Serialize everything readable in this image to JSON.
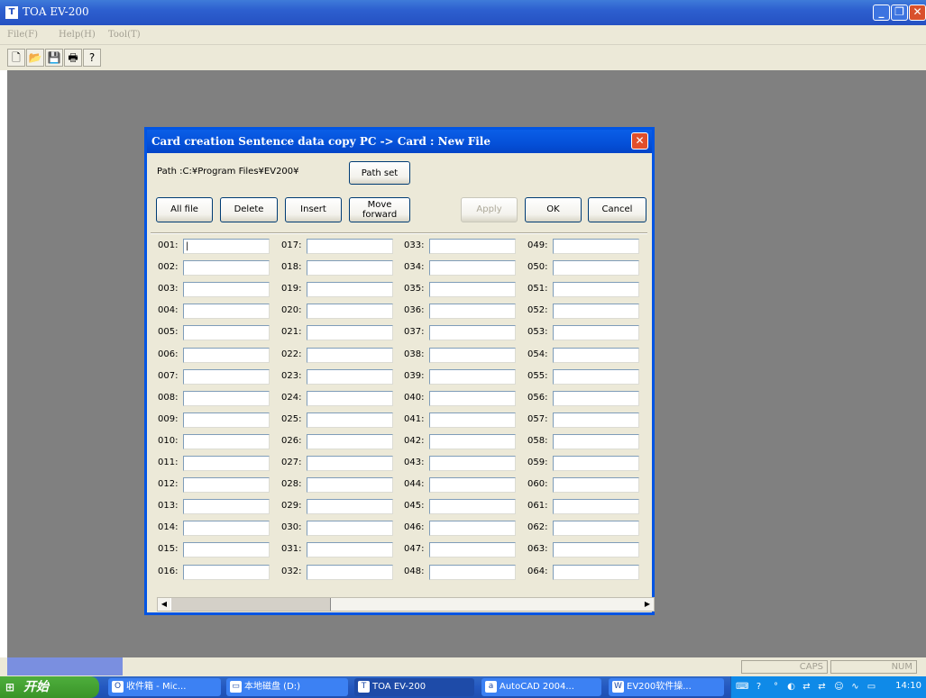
{
  "app": {
    "title": "TOA EV-200",
    "menu": [
      "File(F)",
      "Help(H)",
      "Tool(T)"
    ],
    "toolbar_icons": [
      "new-file-icon",
      "open-folder-icon",
      "save-disk-icon",
      "print-icon",
      "help-icon"
    ]
  },
  "dialog": {
    "title": "Card creation Sentence data copy PC -> Card : New File",
    "path_label": "Path :C:¥Program Files¥EV200¥",
    "buttons": {
      "path_set": "Path set",
      "all_file": "All file",
      "delete": "Delete",
      "insert": "Insert",
      "move_forward_1": "Move",
      "move_forward_2": "forward",
      "apply": "Apply",
      "ok": "OK",
      "cancel": "Cancel"
    },
    "columns": [
      [
        "001:",
        "002:",
        "003:",
        "004:",
        "005:",
        "006:",
        "007:",
        "008:",
        "009:",
        "010:",
        "011:",
        "012:",
        "013:",
        "014:",
        "015:",
        "016:"
      ],
      [
        "017:",
        "018:",
        "019:",
        "020:",
        "021:",
        "022:",
        "023:",
        "024:",
        "025:",
        "026:",
        "027:",
        "028:",
        "029:",
        "030:",
        "031:",
        "032:"
      ],
      [
        "033:",
        "034:",
        "035:",
        "036:",
        "037:",
        "038:",
        "039:",
        "040:",
        "041:",
        "042:",
        "043:",
        "044:",
        "045:",
        "046:",
        "047:",
        "048:"
      ],
      [
        "049:",
        "050:",
        "051:",
        "052:",
        "053:",
        "054:",
        "055:",
        "056:",
        "057:",
        "058:",
        "059:",
        "060:",
        "061:",
        "062:",
        "063:",
        "064:"
      ]
    ]
  },
  "statusbar": {
    "caps": "CAPS",
    "num": "NUM"
  },
  "taskbar": {
    "start": "开始",
    "tasks": [
      "收件箱 - Mic...",
      "本地磁盘 (D:)",
      "TOA EV-200",
      "AutoCAD 2004...",
      "EV200软件操..."
    ],
    "clock": "14:10"
  }
}
